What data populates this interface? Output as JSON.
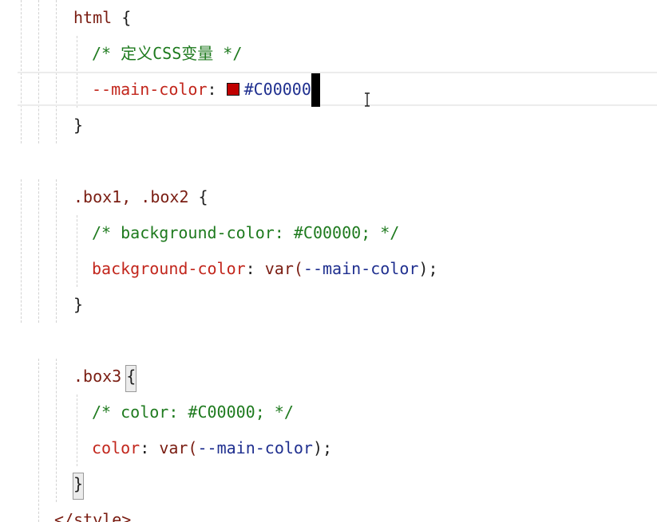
{
  "code": {
    "l1": {
      "sel": "html",
      "brace": " {"
    },
    "l2": {
      "comment": "/* 定义CSS变量 */"
    },
    "l3": {
      "prop": "--main-color",
      "colon": ": ",
      "value": "#C00000",
      "semi": ";",
      "swatch_color": "#C00000"
    },
    "l4": {
      "brace": "}"
    },
    "l5": {
      "sel": ".box1, .box2",
      "brace": " {"
    },
    "l6": {
      "comment": "/* background-color: #C00000; */"
    },
    "l7": {
      "prop": "background-color",
      "colon": ": ",
      "func": "var(",
      "arg": "--main-color",
      "close": ");"
    },
    "l8": {
      "brace": "}"
    },
    "l9": {
      "sel": ".box3",
      "brace": "{"
    },
    "l10": {
      "comment": "/* color: #C00000; */"
    },
    "l11": {
      "prop": "color",
      "colon": ": ",
      "func": "var(",
      "arg": "--main-color",
      "close": ");"
    },
    "l12": {
      "brace": "}"
    },
    "l13": {
      "tag": "</style>"
    }
  },
  "colors": {
    "selector": "#7a1d12",
    "comment": "#1e7a1e",
    "property": "#c2261c",
    "value": "#1f2f8f",
    "accent": "#C00000"
  }
}
